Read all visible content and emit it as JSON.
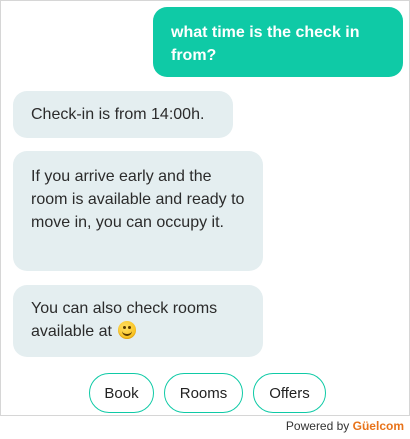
{
  "messages": [
    {
      "sender": "user",
      "text": "what time is the check in from?"
    },
    {
      "sender": "bot",
      "text": "Check-in is from 14:00h."
    },
    {
      "sender": "bot",
      "text": "If you arrive early and the room is available and ready to move in, you can occupy it."
    },
    {
      "sender": "bot",
      "text": "You can also check rooms available at"
    }
  ],
  "emoji": "smiling-face-icon",
  "quick_replies": [
    "Book",
    "Rooms",
    "Offers"
  ],
  "footer": {
    "powered_by": "Powered by",
    "brand": "Güelcom"
  },
  "colors": {
    "accent": "#0fcaa6",
    "bot_bubble": "#e4eef0",
    "brand": "#e8731a"
  }
}
